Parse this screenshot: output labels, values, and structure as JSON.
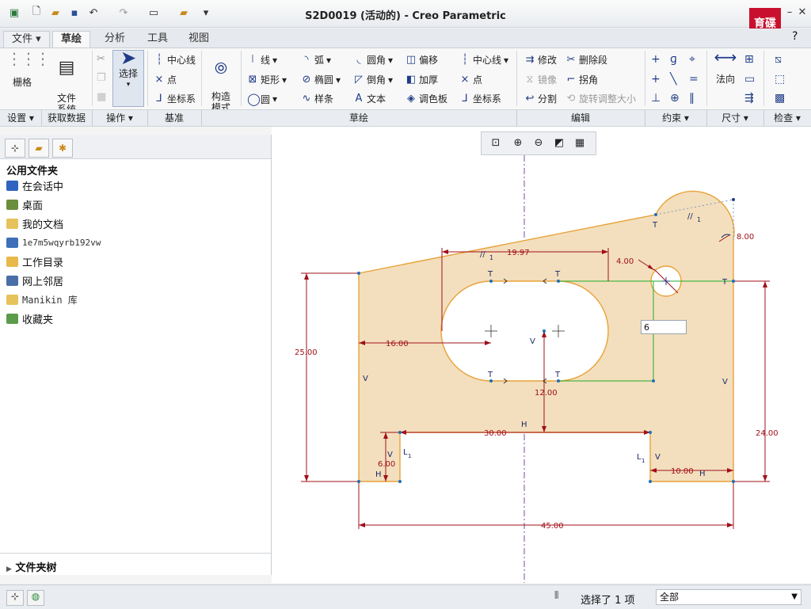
{
  "window": {
    "title": "S2D0019 (活动的) - Creo Parametric",
    "logo_text": "育碟软件"
  },
  "menu_tabs": [
    "文件",
    "草绘",
    "分析",
    "工具",
    "视图"
  ],
  "ribbon": {
    "grid_label": "栅格",
    "file_system_label": "文件\n系统",
    "select_label": "选择",
    "centerline_label": "中心线",
    "point_label": "点",
    "coord_label": "坐标系",
    "construct_label": "构造\n模式",
    "line_label": "线",
    "rect_label": "矩形",
    "circle_label": "圆",
    "arc_label": "弧",
    "ellipse_label": "椭圆",
    "spline_label": "样条",
    "fillet_label": "圆角",
    "chamfer_label": "倒角",
    "text_label": "文本",
    "offset_label": "偏移",
    "thicken_label": "加厚",
    "palette_label": "调色板",
    "centerline2_label": "中心线",
    "point2_label": "点",
    "coord2_label": "坐标系",
    "modify_label": "修改",
    "delete_seg_label": "删除段",
    "mirror_label": "镜像",
    "corner_label": "拐角",
    "divide_label": "分割",
    "rotate_resize_label": "旋转调整大小",
    "normal_label": "法向"
  },
  "groups": [
    "设置",
    "获取数据",
    "操作",
    "基准",
    "草绘",
    "编辑",
    "约束",
    "尺寸",
    "检查"
  ],
  "left_panel": {
    "title": "公用文件夹",
    "items": [
      "在会话中",
      "桌面",
      "我的文档",
      "1e7m5wqyrb192vw",
      "工作目录",
      "网上邻居",
      "Manikin 库",
      "收藏夹"
    ],
    "tree_label": "文件夹树"
  },
  "status": {
    "selected": "选择了 1 项",
    "filter": "全部"
  },
  "sketch": {
    "dims": {
      "d1997": "19.97",
      "d400": "4.00",
      "d800": "8.00",
      "d2500": "25.00",
      "d1600": "16.00",
      "d1200": "12.00",
      "d3000": "30.00",
      "d600": "6.00",
      "d1000": "10.00",
      "d2400": "24.00",
      "d4500": "45.00"
    },
    "input_value": "6",
    "constraints": {
      "T": "T",
      "V": "V",
      "H": "H",
      "L1": "L",
      "sub1": "1",
      "par": "//",
      "p1": "1"
    }
  },
  "colors": {
    "fill": "#f3dfbd",
    "edge": "#e8a23a",
    "dim": "#a0101a",
    "green": "#1fae2a"
  }
}
